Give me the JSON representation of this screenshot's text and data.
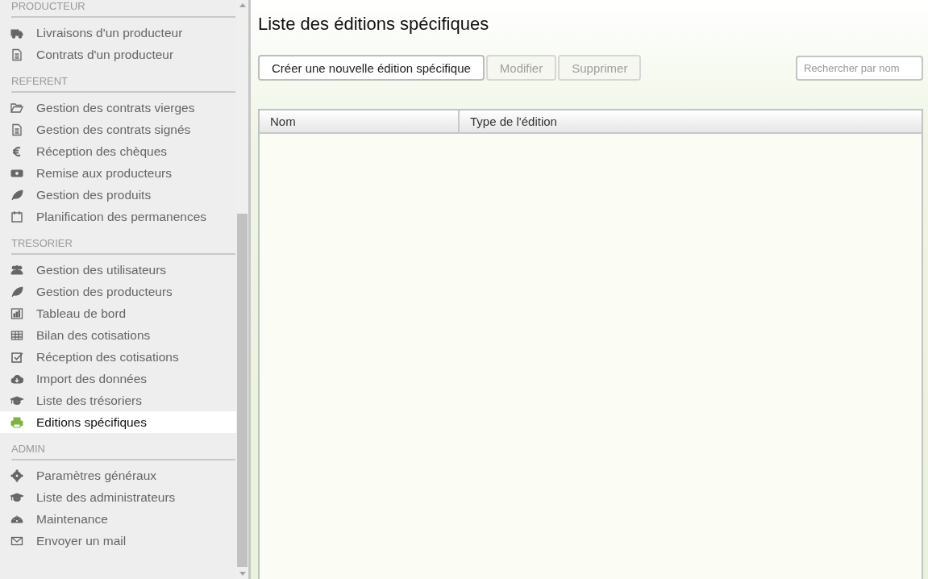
{
  "sidebar": {
    "sections": [
      {
        "title": "PRODUCTEUR",
        "items": [
          {
            "label": "Livraisons d'un producteur",
            "selected": false
          },
          {
            "label": "Contrats d'un producteur",
            "selected": false
          }
        ]
      },
      {
        "title": "REFERENT",
        "items": [
          {
            "label": "Gestion des contrats vierges",
            "selected": false
          },
          {
            "label": "Gestion des contrats signés",
            "selected": false
          },
          {
            "label": "Réception des chèques",
            "selected": false
          },
          {
            "label": "Remise aux producteurs",
            "selected": false
          },
          {
            "label": "Gestion des produits",
            "selected": false
          },
          {
            "label": "Planification des permanences",
            "selected": false
          }
        ]
      },
      {
        "title": "TRESORIER",
        "items": [
          {
            "label": "Gestion des utilisateurs",
            "selected": false
          },
          {
            "label": "Gestion des producteurs",
            "selected": false
          },
          {
            "label": "Tableau de bord",
            "selected": false
          },
          {
            "label": "Bilan des cotisations",
            "selected": false
          },
          {
            "label": "Réception des cotisations",
            "selected": false
          },
          {
            "label": "Import des données",
            "selected": false
          },
          {
            "label": "Liste des trésoriers",
            "selected": false
          },
          {
            "label": "Editions spécifiques",
            "selected": true
          }
        ]
      },
      {
        "title": "ADMIN",
        "items": [
          {
            "label": "Paramètres généraux",
            "selected": false
          },
          {
            "label": "Liste des administrateurs",
            "selected": false
          },
          {
            "label": "Maintenance",
            "selected": false
          },
          {
            "label": "Envoyer un mail",
            "selected": false
          }
        ]
      }
    ]
  },
  "page": {
    "title": "Liste des éditions spécifiques",
    "buttons": [
      {
        "label": "Créer une nouvelle édition spécifique",
        "disabled": false
      },
      {
        "label": "Modifier",
        "disabled": true
      },
      {
        "label": "Supprimer",
        "disabled": true
      }
    ],
    "search": {
      "placeholder": "Rechercher par nom"
    },
    "table": {
      "columns": [
        "Nom",
        "Type de l'édition"
      ]
    }
  }
}
